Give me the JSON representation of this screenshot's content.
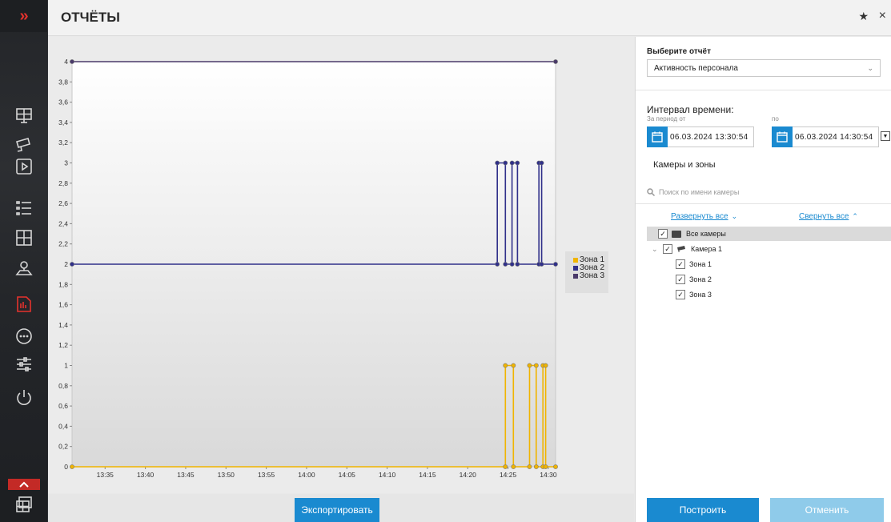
{
  "window": {
    "title": "ОТЧЁТЫ",
    "pin_icon": "pin-icon",
    "close_glyph": "×"
  },
  "sidebar": {
    "items": [
      {
        "name": "monitor-icon"
      },
      {
        "name": "camera-icon"
      },
      {
        "name": "playback-icon"
      },
      {
        "name": "list-icon"
      },
      {
        "name": "layout-icon"
      },
      {
        "name": "map-icon"
      },
      {
        "name": "reports-icon",
        "active": true
      },
      {
        "name": "more-icon"
      },
      {
        "name": "settings-sliders-icon"
      },
      {
        "name": "power-icon"
      }
    ]
  },
  "report": {
    "select_label": "Выберите отчёт",
    "selected_report": "Активность персонала"
  },
  "interval": {
    "label": "Интервал времени:",
    "from_label": "За период от",
    "to_label": "по",
    "from_value": "06.03.2024  13:30:54",
    "to_value": "06.03.2024  14:30:54"
  },
  "cameras": {
    "label": "Камеры и зоны",
    "search_placeholder": "Поиск по имени камеры",
    "expand_all": "Развернуть все",
    "collapse_all": "Свернуть все",
    "tree": {
      "root": "Все камеры",
      "camera": "Камера 1",
      "zones": [
        "Зона 1",
        "Зона 2",
        "Зона 3"
      ]
    }
  },
  "buttons": {
    "export": "Экспортировать",
    "build": "Построить",
    "cancel": "Отменить"
  },
  "chart_data": {
    "type": "line",
    "title": "",
    "xlabel": "",
    "ylabel": "",
    "x_ticks": [
      "13:35",
      "13:40",
      "13:45",
      "13:50",
      "13:55",
      "14:00",
      "14:05",
      "14:10",
      "14:15",
      "14:20",
      "14:25",
      "14:30"
    ],
    "y_ticks": [
      "0",
      "0,2",
      "0,4",
      "0,6",
      "0,8",
      "1",
      "1,2",
      "1,4",
      "1,6",
      "1,8",
      "2",
      "2,2",
      "2,4",
      "2,6",
      "2,8",
      "3",
      "3,2",
      "3,4",
      "3,6",
      "3,8",
      "4"
    ],
    "ylim": [
      0,
      4
    ],
    "xlim": [
      "13:30:54",
      "14:30:54"
    ],
    "legend_position": "right",
    "series": [
      {
        "name": "Зона 1",
        "color": "#f0b400",
        "points": [
          [
            "13:30:54",
            0
          ],
          [
            "14:24:40",
            0
          ],
          [
            "14:24:40",
            1
          ],
          [
            "14:25:40",
            1
          ],
          [
            "14:25:40",
            0
          ],
          [
            "14:27:40",
            0
          ],
          [
            "14:27:40",
            1
          ],
          [
            "14:28:30",
            1
          ],
          [
            "14:28:30",
            0
          ],
          [
            "14:29:20",
            0
          ],
          [
            "14:29:20",
            1
          ],
          [
            "14:29:40",
            1
          ],
          [
            "14:29:40",
            0
          ],
          [
            "14:30:54",
            0
          ]
        ]
      },
      {
        "name": "Зона 2",
        "color": "#30308a",
        "points": [
          [
            "13:30:54",
            2
          ],
          [
            "14:23:40",
            2
          ],
          [
            "14:23:40",
            3
          ],
          [
            "14:24:40",
            3
          ],
          [
            "14:24:40",
            2
          ],
          [
            "14:25:30",
            2
          ],
          [
            "14:25:30",
            3
          ],
          [
            "14:26:10",
            3
          ],
          [
            "14:26:10",
            2
          ],
          [
            "14:28:50",
            2
          ],
          [
            "14:28:50",
            3
          ],
          [
            "14:29:10",
            3
          ],
          [
            "14:29:10",
            2
          ],
          [
            "14:30:54",
            2
          ]
        ]
      },
      {
        "name": "Зона 3",
        "color": "#4a3a6a",
        "points": [
          [
            "13:30:54",
            4
          ],
          [
            "14:30:54",
            4
          ]
        ]
      }
    ]
  }
}
